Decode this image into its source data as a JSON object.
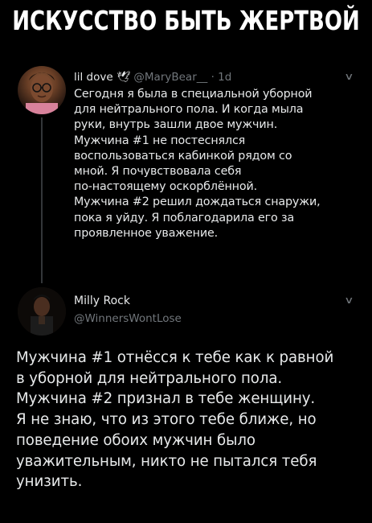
{
  "title": "Искусство быть жертвой",
  "tweet1": {
    "name": "lil dove",
    "handle": "@MaryBear__",
    "time": "· 1d",
    "text": "Сегодня я была в специальной уборной\nдля нейтрального пола. И когда мыла\nруки, внутрь зашли двое мужчин.\nМужчина #1 не постеснялся\nвоспользоваться кабинкой рядом со\nмной. Я почувствовала себя\nпо-настоящему оскорблённой.\nМужчина #2 решил дождаться снаружи,\nпока я уйду. Я поблагодарила его за\nпроявленное уважение."
  },
  "tweet2": {
    "name": "Milly Rock",
    "handle": "@WinnersWontLose",
    "text": "Мужчина #1 отнёсся к тебе как к равной\nв уборной для нейтрального пола.\nМужчина #2 признал в тебе женщину.\nЯ не знаю, что из этого тебе ближе, но\nповедение обоих мужчин было\nуважительным, никто не пытался тебя\nунизить."
  }
}
